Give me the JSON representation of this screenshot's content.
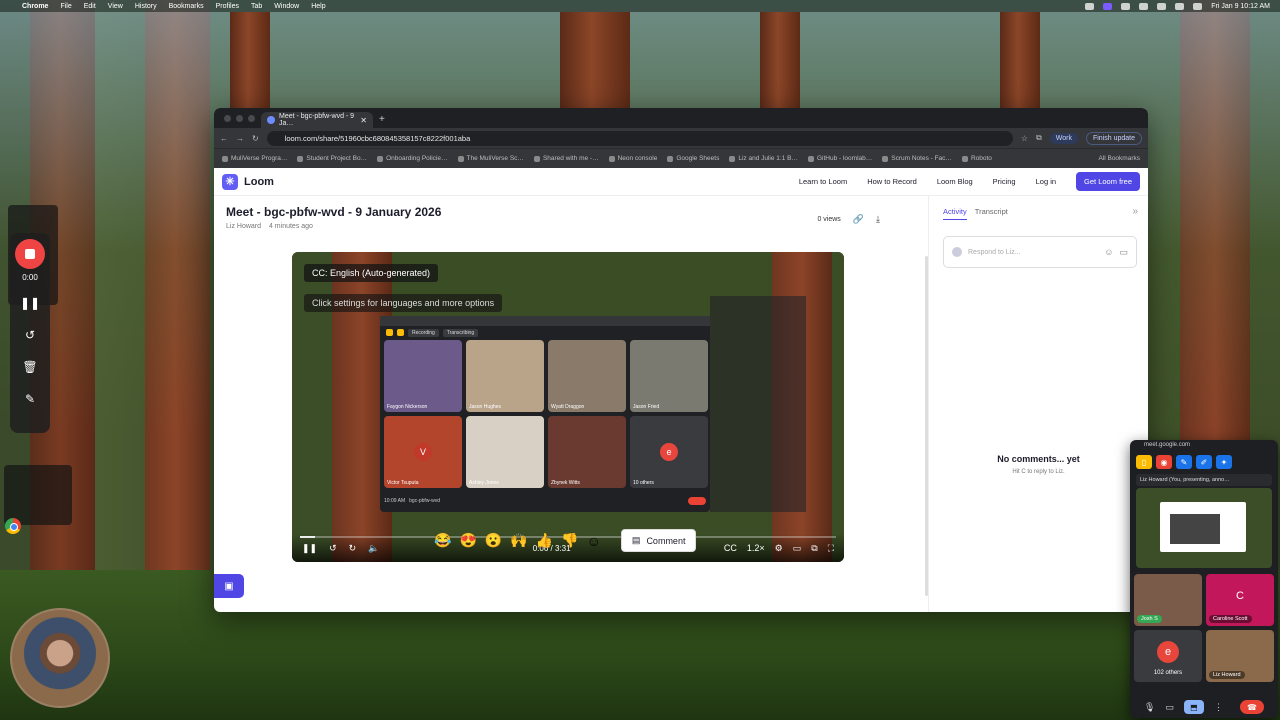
{
  "menubar": {
    "app": "Chrome",
    "items": [
      "File",
      "Edit",
      "View",
      "History",
      "Bookmarks",
      "Profiles",
      "Tab",
      "Window",
      "Help"
    ],
    "clock": "Fri Jan 9  10:12 AM"
  },
  "recorder": {
    "time": "0:00"
  },
  "browser": {
    "tab_title": "Meet - bgc-pbfw-wvd - 9 Ja…",
    "url": "loom.com/share/51960cbc680845358157c8222f001aba",
    "profile_label": "Work",
    "update_label": "Finish update",
    "bookmarks": [
      "MuliVerse Progra…",
      "Student Project Bo…",
      "Onboarding Policie…",
      "The MuliVerse Sc…",
      "Shared with me -…",
      "Neon console",
      "Google Sheets",
      "Liz and Julie 1:1 B…",
      "GitHub - loomlab…",
      "Scrum Notes - Fac…",
      "Roboto"
    ],
    "all_bookmarks": "All Bookmarks"
  },
  "loom": {
    "brand": "Loom",
    "nav": {
      "learn": "Learn to Loom",
      "how": "How to Record",
      "blog": "Loom Blog",
      "pricing": "Pricing",
      "login": "Log in",
      "cta": "Get Loom free"
    },
    "video": {
      "title": "Meet - bgc-pbfw-wvd - 9 January 2026",
      "author": "Liz Howard",
      "age": "4 minutes ago",
      "views": "0 views",
      "cc_label": "CC: English (Auto-generated)",
      "cc_hint": "Click settings for languages and more options",
      "time": "0:06 / 3:31",
      "speed": "1.2×",
      "progress": 0.028
    },
    "reactions": [
      "😂",
      "😍",
      "😮",
      "🙌",
      "👍",
      "👎"
    ],
    "comment_label": "Comment",
    "activity": {
      "tab_activity": "Activity",
      "tab_transcript": "Transcript",
      "placeholder": "Respond to Liz...",
      "empty_title": "No comments... yet",
      "empty_hint": "Hit  C  to reply to Liz."
    }
  },
  "inner_meet": {
    "participants": [
      {
        "name": "Faygon Nickerson",
        "color": "#6b5a8a"
      },
      {
        "name": "Jason Hughes",
        "color": "#b9a48a"
      },
      {
        "name": "Wyatt Draggon",
        "color": "#8a7a6a"
      },
      {
        "name": "Jason Fried",
        "color": "#7a7a70"
      },
      {
        "name": "Victor Tsuputa",
        "color": "#b2452c",
        "letter": "V"
      },
      {
        "name": "Ashley Jones",
        "color": "#d8d0c4"
      },
      {
        "name": "Zbynek Witts",
        "color": "#6a3a30"
      },
      {
        "name": "10 others",
        "color": "#3a3b3f",
        "letter": "e"
      }
    ],
    "time": "10:09 AM",
    "code": "bgc-pbfw-wvd",
    "chip_recording": "Recording",
    "chip_transcribing": "Transcribing"
  },
  "meet_pip": {
    "url": "meet.google.com",
    "presenting": "Liz Howard (You, presenting, anno…",
    "tiles": [
      {
        "label": "Josh S",
        "color": "#7a5a48",
        "green": true
      },
      {
        "label": "Caroline Scott",
        "color": "#c2185b",
        "letter": "C"
      },
      {
        "label": "102 others",
        "color": "#3a3b3f",
        "letter": "e",
        "others": true
      },
      {
        "label": "Liz Howard",
        "color": "#8a6a4a"
      }
    ]
  },
  "colors": {
    "loom_accent": "#4f46e5",
    "record_red": "#ef4444",
    "meet_red": "#ea4335"
  }
}
